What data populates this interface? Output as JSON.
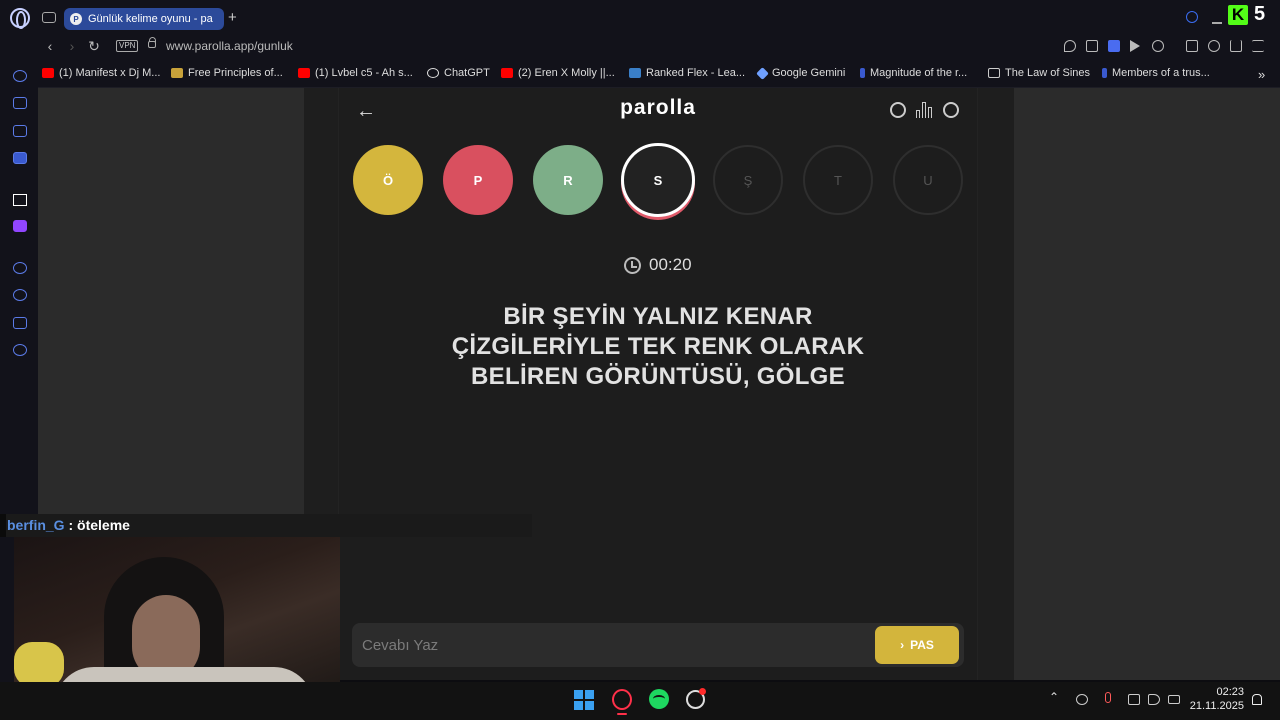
{
  "browser": {
    "tab_title": "Günlük kelime oyunu - pa",
    "tab_favicon_letter": "P",
    "new_tab_label": "+",
    "vpn_label": "VPN",
    "url": "www.parolla.app/gunluk"
  },
  "bookmarks": [
    {
      "label": "(1) Manifest x Dj M...",
      "icon": "youtube-icon",
      "color": "#ff0000"
    },
    {
      "label": "Free Principles of...",
      "icon": "book-icon",
      "color": "#c8a23a"
    },
    {
      "label": "(1) Lvbel c5 - Ah s...",
      "icon": "youtube-icon",
      "color": "#ff0000"
    },
    {
      "label": "ChatGPT",
      "icon": "chatgpt-icon",
      "color": "#dddddd"
    },
    {
      "label": "(2) Eren X Molly ||...",
      "icon": "youtube-icon",
      "color": "#ff0000"
    },
    {
      "label": "Ranked Flex - Lea...",
      "icon": "league-icon",
      "color": "#3a7fc8"
    },
    {
      "label": "Google Gemini",
      "icon": "gemini-icon",
      "color": "#6fa0ff"
    },
    {
      "label": "Magnitude of the r...",
      "icon": "bookmark-icon",
      "color": "#3a5ad0"
    },
    {
      "label": "The Law of Sines",
      "icon": "image-icon",
      "color": "#cccccc"
    },
    {
      "label": "Members of a trus...",
      "icon": "bookmark-icon",
      "color": "#3a5ad0"
    }
  ],
  "app": {
    "title": "parolla",
    "timer": "00:20",
    "question": "BİR ŞEYİN YALNIZ KENAR ÇİZGİLERİYLE TEK RENK OLARAK BELİREN GÖRÜNTÜSÜ, GÖLGE",
    "letters": [
      {
        "letter": "Ö",
        "state": "answered-correct",
        "color": "#d4b63d"
      },
      {
        "letter": "P",
        "state": "answered-wrong",
        "color": "#d9505f"
      },
      {
        "letter": "R",
        "state": "answered-correct",
        "color": "#7dae88"
      },
      {
        "letter": "S",
        "state": "current",
        "color": "#222222"
      },
      {
        "letter": "Ş",
        "state": "pending",
        "color": "#1d1d1d"
      },
      {
        "letter": "T",
        "state": "pending",
        "color": "#1d1d1d"
      },
      {
        "letter": "U",
        "state": "pending",
        "color": "#1d1d1d"
      }
    ],
    "answer_placeholder": "Cevabı Yaz",
    "pass_label": "PAS"
  },
  "stream": {
    "chat_user": "berfin_G",
    "chat_separator": " : ",
    "chat_message": "öteleme"
  },
  "taskbar": {
    "time": "02:23",
    "date": "21.11.2025"
  }
}
